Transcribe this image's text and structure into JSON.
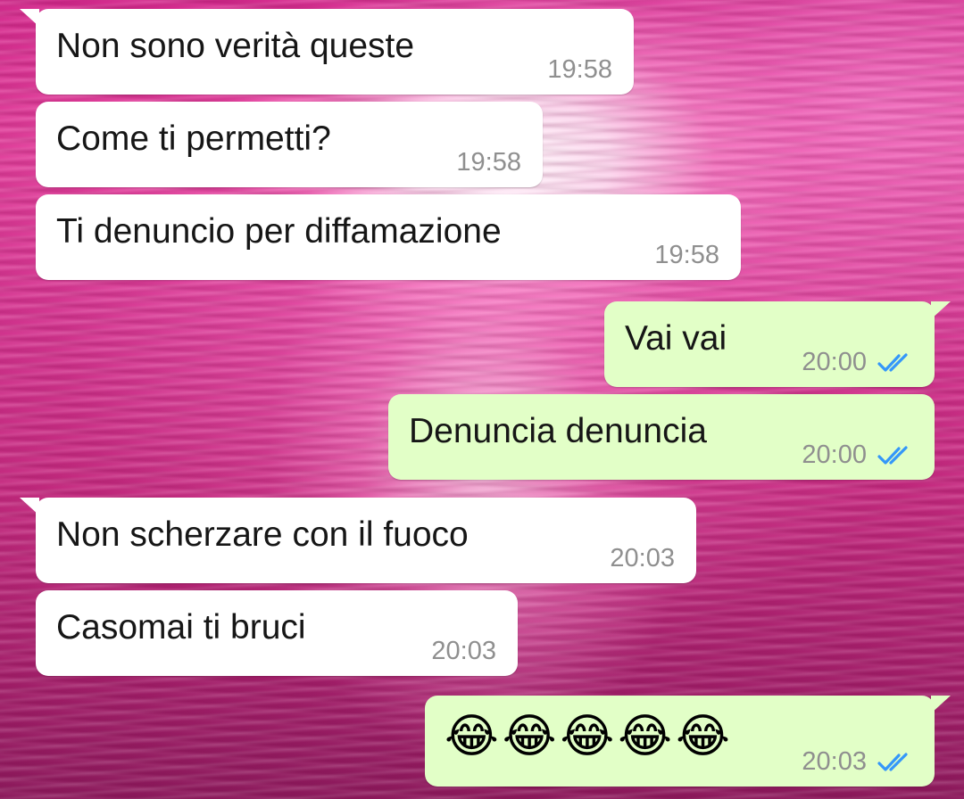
{
  "conversation": {
    "messages": [
      {
        "direction": "incoming",
        "text": "Non sono verità queste",
        "time": "19:58"
      },
      {
        "direction": "incoming",
        "text": "Come ti permetti?",
        "time": "19:58"
      },
      {
        "direction": "incoming",
        "text": "Ti denuncio per diffamazione",
        "time": "19:58"
      },
      {
        "direction": "outgoing",
        "text": "Vai vai",
        "time": "20:00",
        "status": "read"
      },
      {
        "direction": "outgoing",
        "text": "Denuncia denuncia",
        "time": "20:00",
        "status": "read"
      },
      {
        "direction": "incoming",
        "text": "Non scherzare con il fuoco",
        "time": "20:03"
      },
      {
        "direction": "incoming",
        "text": "Casomai ti bruci",
        "time": "20:03"
      },
      {
        "direction": "outgoing",
        "emojis": [
          "😂",
          "😂",
          "😂",
          "😂",
          "😂"
        ],
        "time": "20:03",
        "status": "read"
      }
    ]
  },
  "colors": {
    "incoming_bubble": "#ffffff",
    "outgoing_bubble": "#e2ffc7",
    "read_ticks": "#3497f9",
    "timestamp": "#8f8f8f",
    "message_text": "#161616"
  },
  "icons": {
    "read_status": "double-check-icon"
  }
}
